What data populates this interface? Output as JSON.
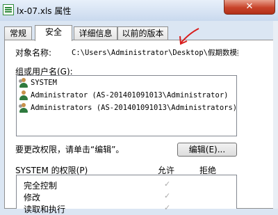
{
  "window": {
    "title": "lx-07.xls 属性",
    "close_label": "✕"
  },
  "tabs": [
    {
      "label": "常规",
      "active": false
    },
    {
      "label": "安全",
      "active": true
    },
    {
      "label": "详细信息",
      "active": false
    },
    {
      "label": "以前的版本",
      "active": false
    }
  ],
  "security": {
    "object_name_label": "对象名称:",
    "object_name_value": "C:\\Users\\Administrator\\Desktop\\假期数模拍",
    "group_label": "组或用户名(G):",
    "users": [
      {
        "name": "SYSTEM",
        "icon": "user-group-icon"
      },
      {
        "name": "Administrator (AS-201401091013\\Administrator)",
        "icon": "user-icon"
      },
      {
        "name": "Administrators (AS-201401091013\\Administrators)",
        "icon": "user-group-icon"
      }
    ],
    "change_hint": "要更改权限，请单击“编辑”。",
    "edit_button": "编辑(E)...",
    "permissions_label": "SYSTEM 的权限(P)",
    "allow_header": "允许",
    "deny_header": "拒绝",
    "permissions": [
      {
        "name": "完全控制",
        "allow": "✓"
      },
      {
        "name": "修改",
        "allow": "✓"
      },
      {
        "name": "读取和执行",
        "allow": "✓"
      }
    ]
  }
}
